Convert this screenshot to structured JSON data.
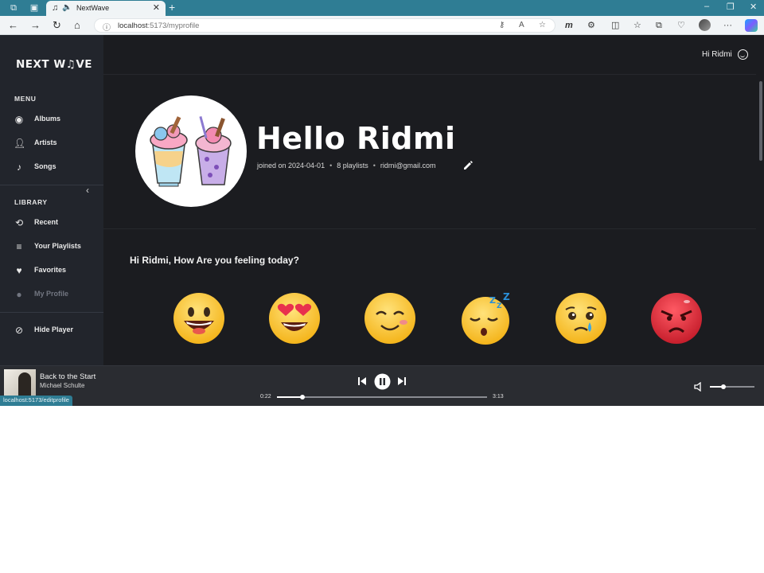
{
  "browser": {
    "tab_title": "NextWave",
    "url_host": "localhost",
    "url_path": ":5173/myprofile",
    "status_url": "localhost:5173/editprofile"
  },
  "sidebar": {
    "logo": "NEXT W♫VE",
    "menu_title": "MENU",
    "menu_items": [
      {
        "label": "Albums",
        "icon": "disc-icon"
      },
      {
        "label": "Artists",
        "icon": "person-icon"
      },
      {
        "label": "Songs",
        "icon": "music-note-icon"
      }
    ],
    "library_title": "LIBRARY",
    "library_items": [
      {
        "label": "Recent",
        "icon": "history-icon"
      },
      {
        "label": "Your Playlists",
        "icon": "playlist-icon"
      },
      {
        "label": "Favorites",
        "icon": "heart-icon"
      },
      {
        "label": "My Profile",
        "icon": "profile-icon",
        "active": true
      }
    ],
    "hide_player": "Hide Player"
  },
  "header": {
    "greeting": "Hi Ridmi"
  },
  "profile": {
    "hello": "Hello Ridmi",
    "joined": "joined on 2024-04-01",
    "playlists": "8 playlists",
    "email": "ridmi@gmail.com"
  },
  "mood": {
    "question": "Hi Ridmi, How Are you feeling today?",
    "moods": [
      "happy",
      "love",
      "content",
      "sleepy",
      "sad",
      "angry"
    ]
  },
  "player": {
    "song": "Back to the Start",
    "artist": "Michael Schulte",
    "elapsed": "0:22",
    "duration": "3:13",
    "progress": 0.12,
    "volume": 0.3
  },
  "colors": {
    "accent": "#2f7d94",
    "background": "#1b1c20",
    "sidebar": "#22252c",
    "player": "#2a2c31"
  }
}
